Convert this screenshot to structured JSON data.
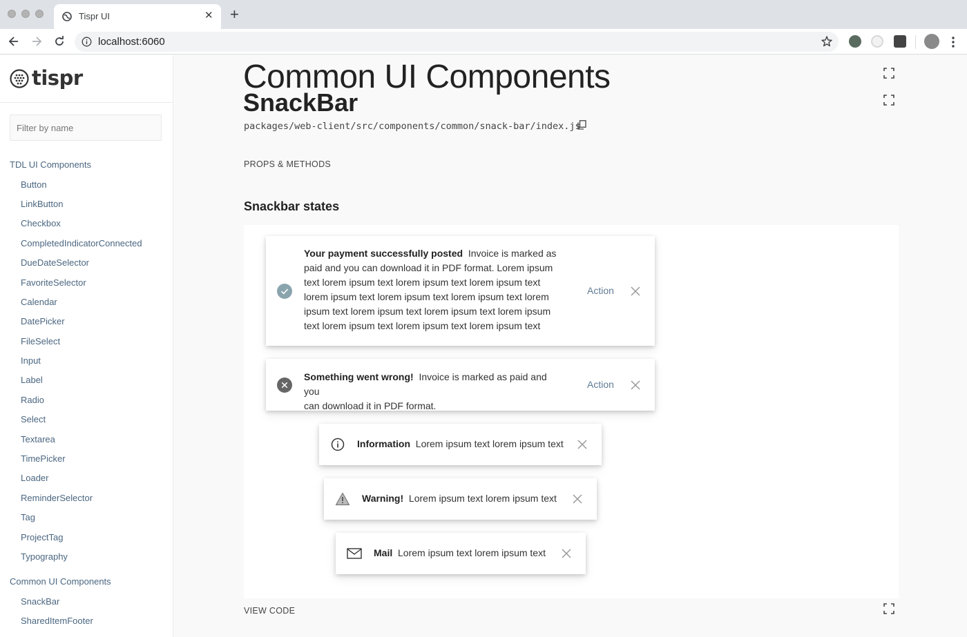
{
  "browser": {
    "tab_title": "Tispr UI",
    "tab_close": "✕",
    "new_tab": "+",
    "url": "localhost:6060"
  },
  "sidebar": {
    "logo_text": "tispr",
    "filter_placeholder": "Filter by name",
    "sections": [
      {
        "title": "TDL UI Components",
        "items": [
          "Button",
          "LinkButton",
          "Checkbox",
          "CompletedIndicatorConnected",
          "DueDateSelector",
          "FavoriteSelector",
          "Calendar",
          "DatePicker",
          "FileSelect",
          "Input",
          "Label",
          "Radio",
          "Select",
          "Textarea",
          "TimePicker",
          "Loader",
          "ReminderSelector",
          "Tag",
          "ProjectTag",
          "Typography"
        ]
      },
      {
        "title": "Common UI Components",
        "items": [
          "SnackBar",
          "SharedItemFooter"
        ]
      }
    ]
  },
  "main": {
    "title": "Common UI Components",
    "subtitle": "SnackBar",
    "path": "packages/web-client/src/components/common/snack-bar/index.js",
    "props_link": "PROPS & METHODS",
    "section_title": "Snackbar states",
    "view_code": "VIEW CODE"
  },
  "snackbars": {
    "success": {
      "icon": "check-circle-icon",
      "bold": "Your payment successfully posted",
      "lines": [
        "Invoice is marked as",
        "paid and you can download it in PDF format. Lorem ipsum",
        "text lorem ipsum text lorem ipsum text lorem ipsum text",
        "lorem ipsum text lorem ipsum text lorem ipsum text lorem",
        "ipsum text lorem ipsum text lorem ipsum text lorem ipsum",
        "text lorem ipsum text lorem ipsum text lorem ipsum text"
      ],
      "action": "Action"
    },
    "error": {
      "icon": "error-circle-icon",
      "bold": "Something went wrong!",
      "lines": [
        "Invoice is marked as paid and you",
        "can download it in PDF format."
      ],
      "action": "Action"
    },
    "info": {
      "icon": "info-icon",
      "bold": "Information",
      "text": "Lorem ipsum text lorem ipsum text"
    },
    "warning": {
      "icon": "warning-icon",
      "bold": "Warning!",
      "text": "Lorem ipsum text lorem ipsum text"
    },
    "mail": {
      "icon": "mail-icon",
      "bold": "Mail",
      "text": "Lorem ipsum text lorem ipsum text"
    }
  },
  "colors": {
    "sidebar_link": "#4a6680",
    "action_link": "#607b95",
    "success_icon": "#8aa4ad",
    "error_icon": "#666666"
  }
}
